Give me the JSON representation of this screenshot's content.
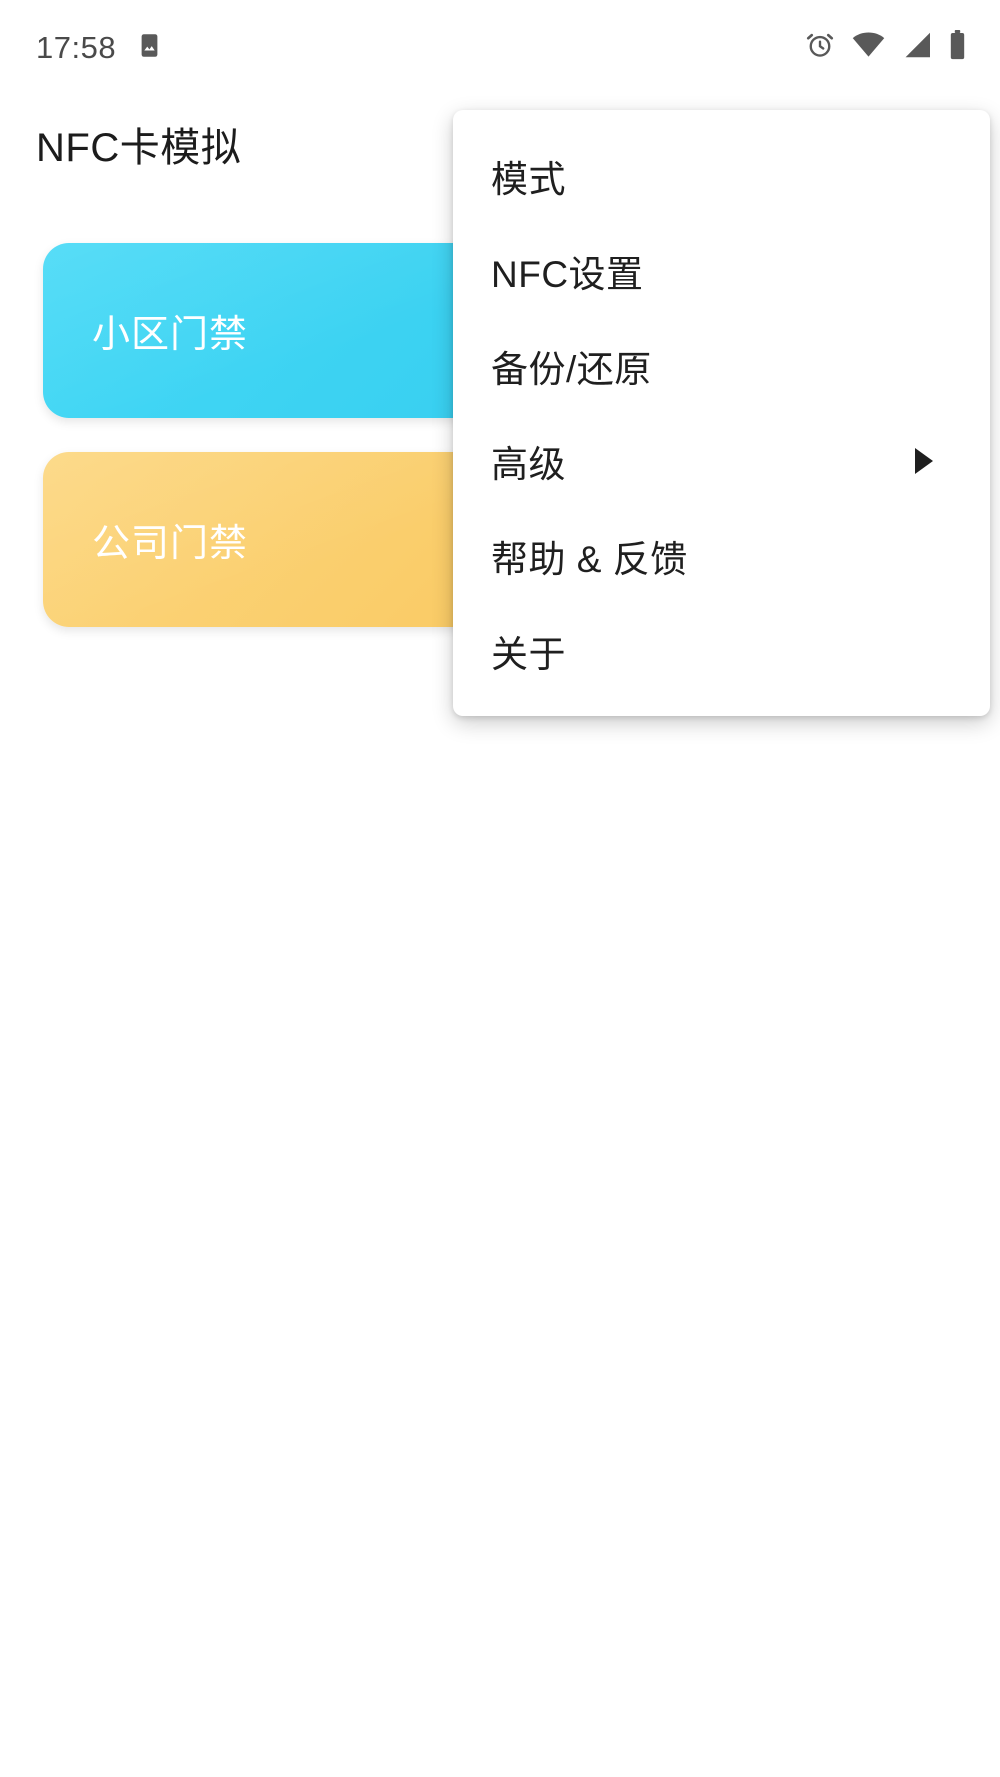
{
  "status_bar": {
    "time": "17:58",
    "left_icons": [
      {
        "name": "image-icon",
        "glyph": "image"
      }
    ],
    "right_icons": [
      {
        "name": "alarm-clock-icon",
        "glyph": "alarm"
      },
      {
        "name": "wifi-icon",
        "glyph": "wifi"
      },
      {
        "name": "cellular-signal-icon",
        "glyph": "signal"
      },
      {
        "name": "battery-icon",
        "glyph": "battery"
      }
    ],
    "icon_color": "#595959"
  },
  "app": {
    "title": "NFC卡模拟"
  },
  "cards": [
    {
      "label": "小区门禁",
      "color": "#45D9F6",
      "text_color": "#FFFFFF"
    },
    {
      "label": "公司门禁",
      "color": "#FBD071",
      "text_color": "#FFFFFF"
    }
  ],
  "overflow_menu": {
    "visible": true,
    "items": [
      {
        "label": "模式",
        "has_submenu": false
      },
      {
        "label": "NFC设置",
        "has_submenu": false
      },
      {
        "label": "备份/还原",
        "has_submenu": false
      },
      {
        "label": "高级",
        "has_submenu": true
      },
      {
        "label": "帮助 & 反馈",
        "has_submenu": false
      },
      {
        "label": "关于",
        "has_submenu": false
      }
    ]
  }
}
